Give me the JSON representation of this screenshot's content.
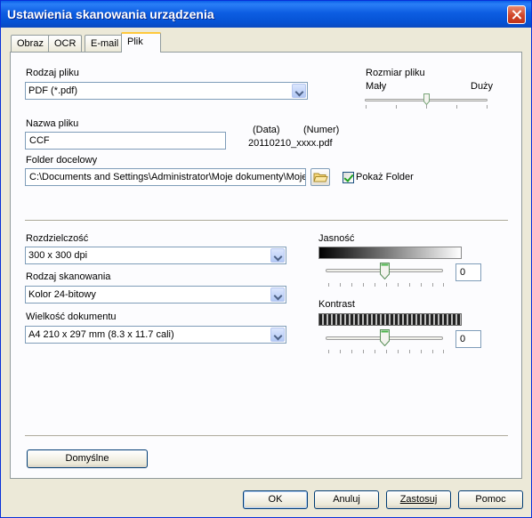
{
  "window": {
    "title": "Ustawienia skanowania urządzenia"
  },
  "tabs": [
    {
      "label": "Obraz"
    },
    {
      "label": "OCR"
    },
    {
      "label": "E-mail"
    },
    {
      "label": "Plik"
    }
  ],
  "active_tab": "Plik",
  "file_type": {
    "label": "Rodzaj pliku",
    "value": "PDF (*.pdf)"
  },
  "file_size": {
    "label": "Rozmiar pliku",
    "min_label": "Mały",
    "max_label": "Duży",
    "level_fraction": 0.52
  },
  "file_name": {
    "label": "Nazwa pliku",
    "value": "CCF",
    "date_header": "(Data)",
    "number_header": "(Numer)",
    "example": "20110210_xxxx.pdf"
  },
  "dest_folder": {
    "label": "Folder docelowy",
    "value": "C:\\Documents and Settings\\Administrator\\Moje dokumenty\\Moje",
    "show_folder_label": "Pokaż Folder",
    "show_folder_checked": true
  },
  "resolution": {
    "label": "Rozdzielczość",
    "value": "300 x 300 dpi"
  },
  "scan_type": {
    "label": "Rodzaj skanowania",
    "value": "Kolor 24-bitowy"
  },
  "doc_size": {
    "label": "Wielkość dokumentu",
    "value": "A4 210 x 297 mm (8.3 x 11.7 cali)"
  },
  "brightness": {
    "label": "Jasność",
    "value": "0",
    "level_fraction": 0.5
  },
  "contrast": {
    "label": "Kontrast",
    "value": "0",
    "level_fraction": 0.5
  },
  "buttons": {
    "defaults": "Domyślne",
    "ok": "OK",
    "cancel": "Anuluj",
    "apply": "Zastosuj",
    "help": "Pomoc"
  },
  "colors": {
    "titlebar": "#0552d4",
    "dialog_bg": "#ece9d8",
    "tab_highlight": "#ffc83c",
    "checkmark": "#21a121"
  }
}
